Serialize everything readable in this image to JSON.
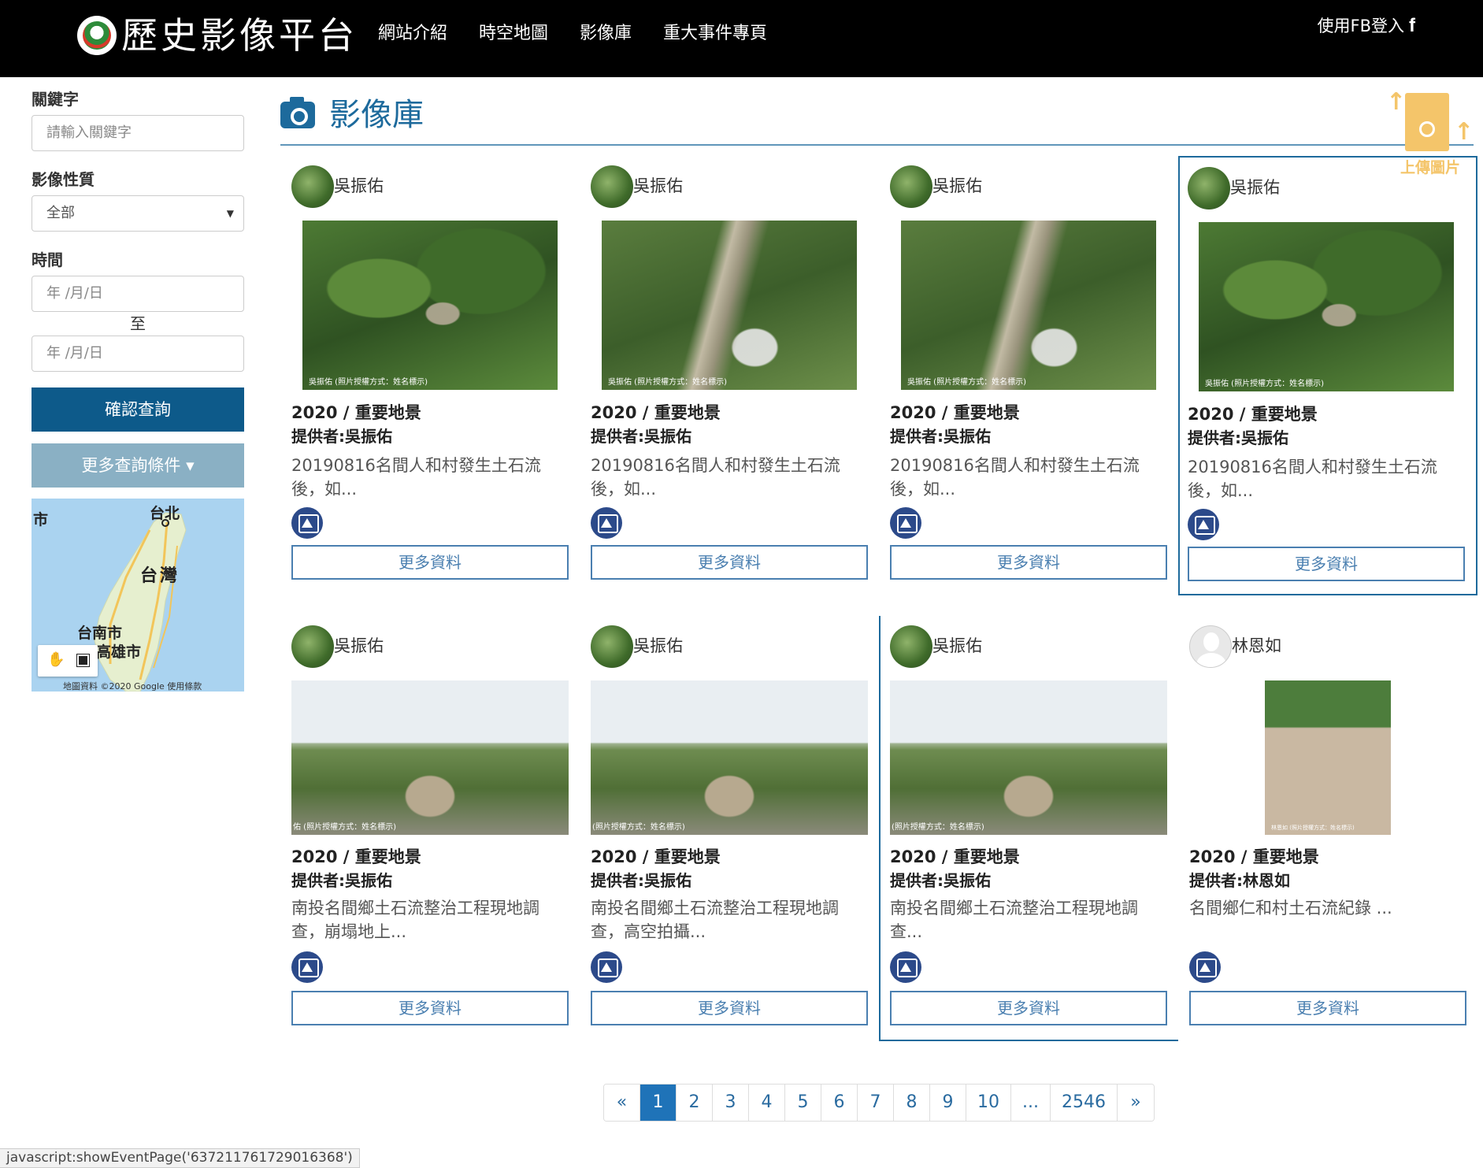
{
  "header": {
    "site_title": "歷史影像平台",
    "nav": [
      "網站介紹",
      "時空地圖",
      "影像庫",
      "重大事件專頁"
    ],
    "login_label": "使用FB登入",
    "fb_glyph": "f"
  },
  "sidebar": {
    "keyword_label": "關鍵字",
    "keyword_placeholder": "請輸入關鍵字",
    "type_label": "影像性質",
    "type_selected": "全部",
    "time_label": "時間",
    "date_from": "年 /月/日",
    "to_label": "至",
    "date_to": "年 /月/日",
    "search_button": "確認查詢",
    "more_conditions": "更多查詢條件",
    "map_labels": [
      "市",
      "台北",
      "台灣",
      "台南市",
      "高雄市"
    ],
    "map_copyright": "地圖資料 ©2020 Google 使用條款"
  },
  "main": {
    "title": "影像庫",
    "upload_label": "上傳圖片",
    "cards": [
      {
        "author": "吳振佑",
        "year_type": "2020 / 重要地景",
        "provider": "提供者:吳振佑",
        "desc": "20190816名間人和村發生土石流後，如...",
        "more": "更多資料",
        "caption": "吳振佑 (照片授權方式：姓名標示)"
      },
      {
        "author": "吳振佑",
        "year_type": "2020 / 重要地景",
        "provider": "提供者:吳振佑",
        "desc": "20190816名間人和村發生土石流後，如...",
        "more": "更多資料",
        "caption": "吳振佑 (照片授權方式：姓名標示)"
      },
      {
        "author": "吳振佑",
        "year_type": "2020 / 重要地景",
        "provider": "提供者:吳振佑",
        "desc": "20190816名間人和村發生土石流後，如...",
        "more": "更多資料",
        "caption": "吳振佑 (照片授權方式：姓名標示)"
      },
      {
        "author": "吳振佑",
        "year_type": "2020 / 重要地景",
        "provider": "提供者:吳振佑",
        "desc": "20190816名間人和村發生土石流後，如...",
        "more": "更多資料",
        "caption": "吳振佑 (照片授權方式：姓名標示)"
      },
      {
        "author": "吳振佑",
        "year_type": "2020 / 重要地景",
        "provider": "提供者:吳振佑",
        "desc": "南投名間鄉土石流整治工程現地調查，崩塌地上...",
        "more": "更多資料",
        "caption": "佑 (照片授權方式：姓名標示)"
      },
      {
        "author": "吳振佑",
        "year_type": "2020 / 重要地景",
        "provider": "提供者:吳振佑",
        "desc": "南投名間鄉土石流整治工程現地調查，高空拍攝...",
        "more": "更多資料",
        "caption": "(照片授權方式：姓名標示)"
      },
      {
        "author": "吳振佑",
        "year_type": "2020 / 重要地景",
        "provider": "提供者:吳振佑",
        "desc": "南投名間鄉土石流整治工程現地調查...",
        "more": "更多資料",
        "caption": "(照片授權方式：姓名標示)"
      },
      {
        "author": "林恩如",
        "year_type": "2020 / 重要地景",
        "provider": "提供者:林恩如",
        "desc": "名間鄉仁和村土石流紀錄 ...",
        "more": "更多資料",
        "caption": "林恩如 (照片授權方式：姓名標示)"
      }
    ]
  },
  "pagination": {
    "prev": "«",
    "pages": [
      "1",
      "2",
      "3",
      "4",
      "5",
      "6",
      "7",
      "8",
      "9",
      "10",
      "...",
      "2546"
    ],
    "current": "1",
    "next": "»"
  },
  "status_bar": "javascript:showEventPage('637211761729016368')"
}
